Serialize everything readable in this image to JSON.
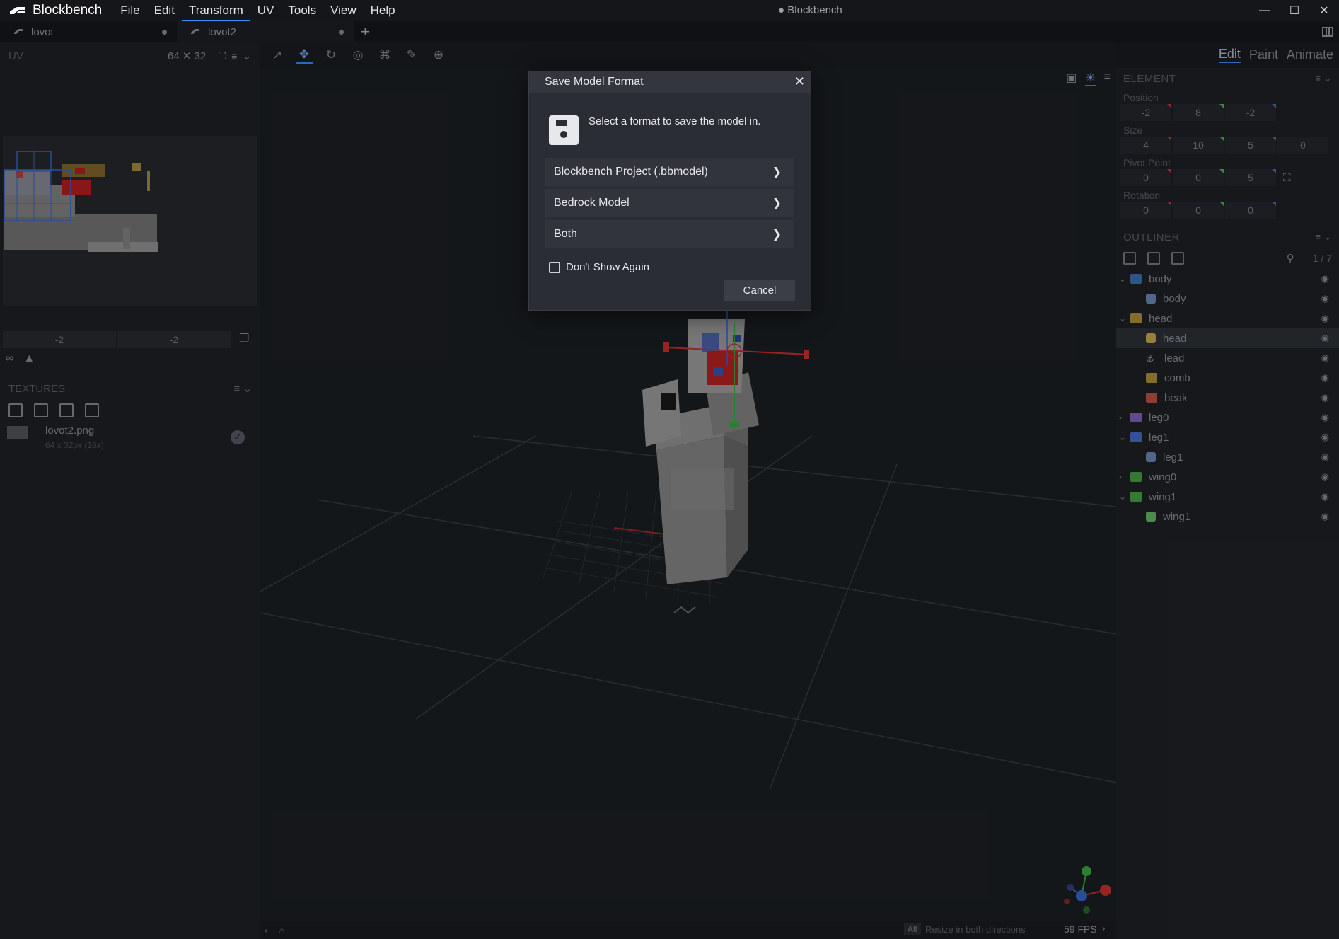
{
  "app": {
    "name": "Blockbench",
    "window_title": "● Blockbench",
    "menu": [
      "File",
      "Edit",
      "Transform",
      "UV",
      "Tools",
      "View",
      "Help"
    ],
    "active_menu": "Transform",
    "colors": {
      "accent": "#3e90ff",
      "background": "#1b1d22",
      "panel": "#202227"
    }
  },
  "tabs": [
    {
      "label": "lovot",
      "icon": "model-icon",
      "unsaved": true
    },
    {
      "label": "lovot2",
      "icon": "model-icon",
      "unsaved": true,
      "active": true
    }
  ],
  "uv_panel": {
    "title": "UV",
    "size": "64 ✕ 32",
    "coords": [
      "-2",
      "-2"
    ]
  },
  "textures_panel": {
    "title": "TEXTURES",
    "items": [
      {
        "name": "lovot2.png",
        "meta": "64 x 32px (16x)"
      }
    ]
  },
  "mode_tabs": [
    "Edit",
    "Paint",
    "Animate"
  ],
  "active_mode": "Edit",
  "element_panel": {
    "title": "ELEMENT",
    "position": {
      "label": "Position",
      "values": [
        "-2",
        "8",
        "-2"
      ]
    },
    "size": {
      "label": "Size",
      "values": [
        "4",
        "10",
        "5",
        "0"
      ]
    },
    "pivot": {
      "label": "Pivot Point",
      "values": [
        "0",
        "0",
        "5"
      ]
    },
    "rotation": {
      "label": "Rotation",
      "values": [
        "0",
        "0",
        "0"
      ]
    }
  },
  "outliner": {
    "title": "OUTLINER",
    "count": "1 / 7",
    "items": [
      {
        "label": "body",
        "type": "group",
        "expanded": true,
        "depth": 0,
        "color": "#3e78b8"
      },
      {
        "label": "body",
        "type": "cube",
        "depth": 1,
        "color": "#6d8fbf"
      },
      {
        "label": "head",
        "type": "group",
        "expanded": true,
        "depth": 0,
        "color": "#b8963e"
      },
      {
        "label": "head",
        "type": "cube",
        "depth": 1,
        "color": "#d1b155",
        "selected": true
      },
      {
        "label": "lead",
        "type": "locator",
        "depth": 1,
        "color": "#9aa0a8"
      },
      {
        "label": "comb",
        "type": "group",
        "depth": 1,
        "color": "#b8963e"
      },
      {
        "label": "beak",
        "type": "group",
        "depth": 1,
        "color": "#c0584a"
      },
      {
        "label": "leg0",
        "type": "group",
        "expanded": false,
        "depth": 0,
        "color": "#8a63c6"
      },
      {
        "label": "leg1",
        "type": "group",
        "expanded": true,
        "depth": 0,
        "color": "#4a6fd0"
      },
      {
        "label": "leg1",
        "type": "cube",
        "depth": 1,
        "color": "#6d8fbf"
      },
      {
        "label": "wing0",
        "type": "group",
        "expanded": false,
        "depth": 0,
        "color": "#4aa84a"
      },
      {
        "label": "wing1",
        "type": "group",
        "expanded": true,
        "depth": 0,
        "color": "#4aa84a"
      },
      {
        "label": "wing1",
        "type": "cube",
        "depth": 1,
        "color": "#6bbf6b"
      }
    ]
  },
  "status": {
    "key": "Alt",
    "hint": "Resize in both directions",
    "fps": "59 FPS"
  },
  "dialog": {
    "title": "Save Model Format",
    "message": "Select a format to save the model in.",
    "options": [
      "Blockbench Project (.bbmodel)",
      "Bedrock Model",
      "Both"
    ],
    "checkbox_label": "Don't Show Again",
    "checkbox_checked": false,
    "cancel_label": "Cancel"
  }
}
